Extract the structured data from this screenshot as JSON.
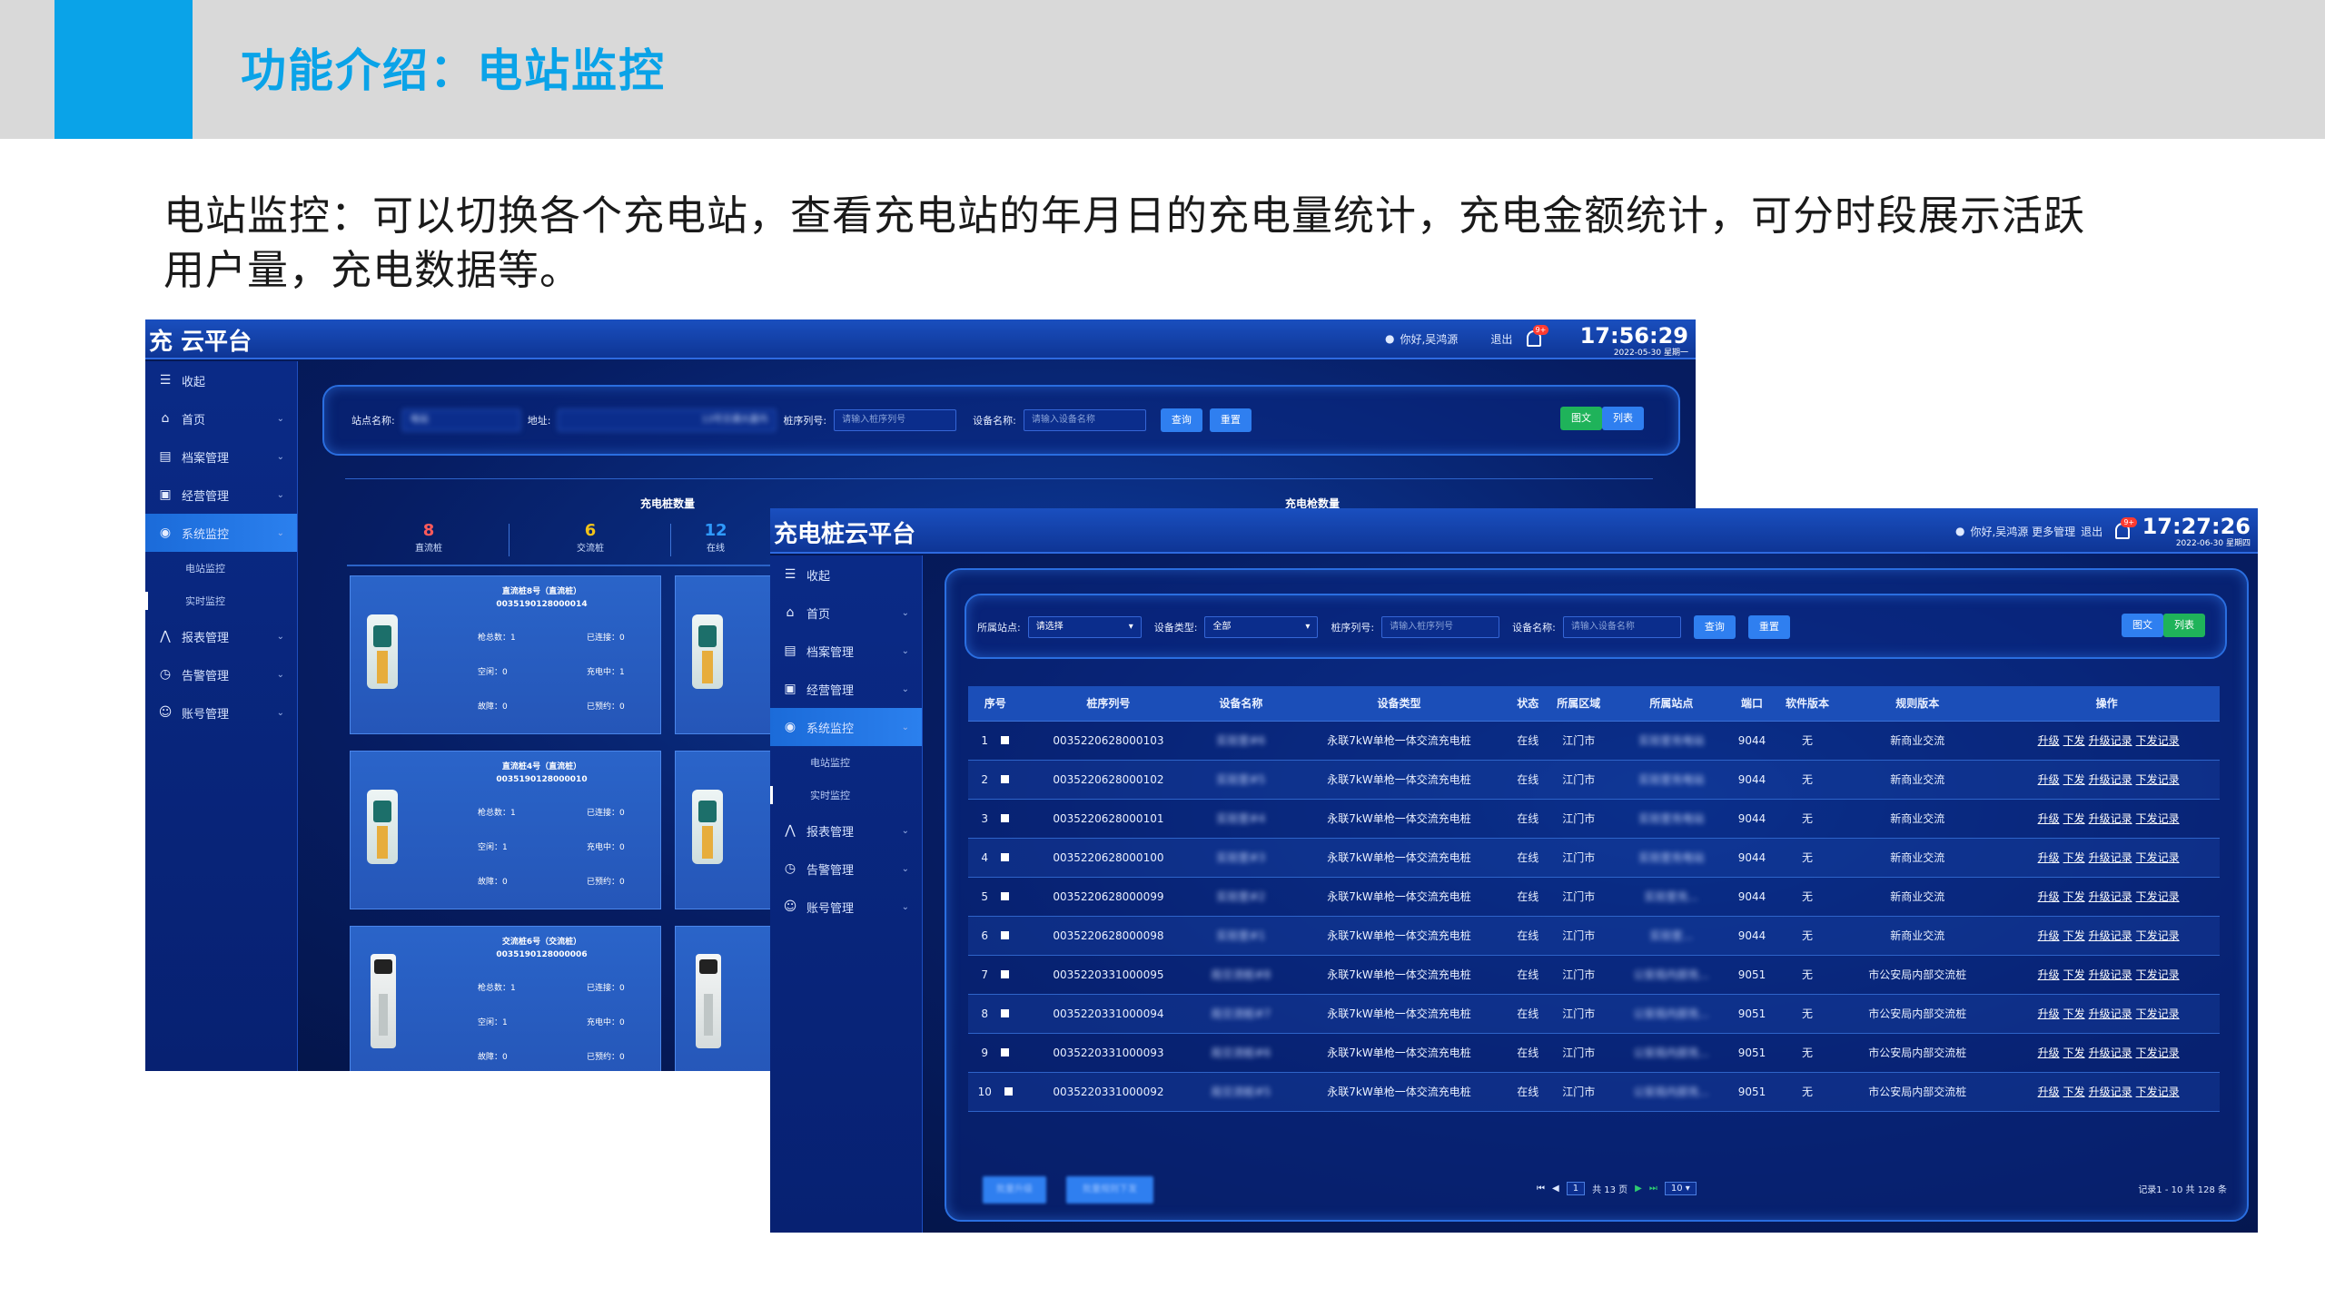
{
  "slide": {
    "title": "功能介绍：电站监控",
    "description": "电站监控：可以切换各个充电站，查看充电站的年月日的充电量统计，充电金额统计，可分时段展示活跃用户量，充电数据等。"
  },
  "colors": {
    "accent": "#0aa3e8",
    "bar": "#d9d9d9",
    "app_bg": "#061d63",
    "active_nav": "#1b6bd9"
  },
  "shot1": {
    "app_title": "充        云平台",
    "user": "你好,吴鸿源",
    "logout": "退出",
    "bell_badge": "9+",
    "time": "17:56:29",
    "date": "2022-05-30 星期一",
    "nav": [
      {
        "label": "收起",
        "icon": "menu-icon"
      },
      {
        "label": "首页",
        "icon": "home-icon"
      },
      {
        "label": "档案管理",
        "icon": "archive-icon"
      },
      {
        "label": "经营管理",
        "icon": "business-icon"
      },
      {
        "label": "系统监控",
        "icon": "monitor-icon"
      },
      {
        "label": "电站监控"
      },
      {
        "label": "实时监控"
      },
      {
        "label": "报表管理",
        "icon": "report-icon"
      },
      {
        "label": "告警管理",
        "icon": "alarm-icon"
      },
      {
        "label": "账号管理",
        "icon": "account-icon"
      }
    ],
    "search": {
      "station_label": "站点名称:",
      "station_value": "电站",
      "address_label": "地址:",
      "address_value": "13号交通大厦内",
      "serial_label": "桩序列号:",
      "serial_placeholder": "请输入桩序列号",
      "device_label": "设备名称:",
      "device_placeholder": "请输入设备名称",
      "query": "查询",
      "reset": "重置",
      "view_card": "图文",
      "view_list": "列表"
    },
    "section_left": "充电桩数量",
    "section_right": "充电枪数量",
    "stats": [
      {
        "value": "8",
        "label": "直流桩",
        "color": "#ff5a5a"
      },
      {
        "value": "6",
        "label": "交流桩",
        "color": "#f0c21a"
      },
      {
        "value": "12",
        "label": "在线",
        "color": "#2f9bff"
      }
    ],
    "cards": [
      {
        "name": "直流桩8号（直流桩）",
        "serial": "0035190128000014",
        "total": "枪总数：1",
        "connected": "已连接：0",
        "idle": "空闲：0",
        "charging": "充电中：1",
        "fault": "故障：0",
        "reserved": "已预约：0"
      },
      {
        "name": "直流桩4号（直流桩）",
        "serial": "0035190128000010",
        "total": "枪总数：1",
        "connected": "已连接：0",
        "idle": "空闲：1",
        "charging": "充电中：0",
        "fault": "故障：0",
        "reserved": "已预约：0"
      },
      {
        "name": "交流桩6号（交流桩）",
        "serial": "0035190128000006",
        "total": "枪总数：1",
        "connected": "已连接：0",
        "idle": "空闲：1",
        "charging": "充电中：0",
        "fault": "故障：0",
        "reserved": "已预约：0"
      }
    ]
  },
  "shot2": {
    "app_title": "充电桩云平台",
    "user": "你好,吴鸿源 更多管理",
    "logout": "退出",
    "bell_badge": "9+",
    "time": "17:27:26",
    "date": "2022-06-30 星期四",
    "nav": [
      {
        "label": "收起",
        "icon": "menu-icon"
      },
      {
        "label": "首页",
        "icon": "home-icon"
      },
      {
        "label": "档案管理",
        "icon": "archive-icon"
      },
      {
        "label": "经营管理",
        "icon": "business-icon"
      },
      {
        "label": "系统监控",
        "icon": "monitor-icon"
      },
      {
        "label": "电站监控"
      },
      {
        "label": "实时监控"
      },
      {
        "label": "报表管理",
        "icon": "report-icon"
      },
      {
        "label": "告警管理",
        "icon": "alarm-icon"
      },
      {
        "label": "账号管理",
        "icon": "account-icon"
      }
    ],
    "search": {
      "station_label": "所属站点:",
      "station_value": "请选择",
      "type_label": "设备类型:",
      "type_value": "全部",
      "serial_label": "桩序列号:",
      "serial_placeholder": "请输入桩序列号",
      "device_label": "设备名称:",
      "device_placeholder": "请输入设备名称",
      "query": "查询",
      "reset": "重置",
      "view_card": "图文",
      "view_list": "列表"
    },
    "table": {
      "headers": [
        "序号",
        "桩序列号",
        "设备名称",
        "设备类型",
        "状态",
        "所属区域",
        "所属站点",
        "端口",
        "软件版本",
        "规则版本",
        "操作"
      ],
      "rows": [
        {
          "no": "1",
          "serial": "0035220628000103",
          "name": "实验室#6",
          "type": "永联7kW单枪一体交流充电桩",
          "status": "在线",
          "area": "江门市",
          "station": "实验室充电站",
          "port": "9044",
          "sw": "无",
          "rule": "新商业交流"
        },
        {
          "no": "2",
          "serial": "0035220628000102",
          "name": "实验室#5",
          "type": "永联7kW单枪一体交流充电桩",
          "status": "在线",
          "area": "江门市",
          "station": "实验室充电站",
          "port": "9044",
          "sw": "无",
          "rule": "新商业交流"
        },
        {
          "no": "3",
          "serial": "0035220628000101",
          "name": "实验室#4",
          "type": "永联7kW单枪一体交流充电桩",
          "status": "在线",
          "area": "江门市",
          "station": "实验室充电站",
          "port": "9044",
          "sw": "无",
          "rule": "新商业交流"
        },
        {
          "no": "4",
          "serial": "0035220628000100",
          "name": "实验室#3",
          "type": "永联7kW单枪一体交流充电桩",
          "status": "在线",
          "area": "江门市",
          "station": "实验室充电站",
          "port": "9044",
          "sw": "无",
          "rule": "新商业交流"
        },
        {
          "no": "5",
          "serial": "0035220628000099",
          "name": "实验室#2",
          "type": "永联7kW单枪一体交流充电桩",
          "status": "在线",
          "area": "江门市",
          "station": "实验室充...",
          "port": "9044",
          "sw": "无",
          "rule": "新商业交流"
        },
        {
          "no": "6",
          "serial": "0035220628000098",
          "name": "实验室#1",
          "type": "永联7kW单枪一体交流充电桩",
          "status": "在线",
          "area": "江门市",
          "station": "实验室...",
          "port": "9044",
          "sw": "无",
          "rule": "新商业交流"
        },
        {
          "no": "7",
          "serial": "0035220331000095",
          "name": "局交流桩#8",
          "type": "永联7kW单枪一体交流充电桩",
          "status": "在线",
          "area": "江门市",
          "station": "公安局内部充...",
          "port": "9051",
          "sw": "无",
          "rule": "市公安局内部交流桩"
        },
        {
          "no": "8",
          "serial": "0035220331000094",
          "name": "局交流桩#7",
          "type": "永联7kW单枪一体交流充电桩",
          "status": "在线",
          "area": "江门市",
          "station": "公安局内部充...",
          "port": "9051",
          "sw": "无",
          "rule": "市公安局内部交流桩"
        },
        {
          "no": "9",
          "serial": "0035220331000093",
          "name": "局交流桩#6",
          "type": "永联7kW单枪一体交流充电桩",
          "status": "在线",
          "area": "江门市",
          "station": "公安局内部充...",
          "port": "9051",
          "sw": "无",
          "rule": "市公安局内部交流桩"
        },
        {
          "no": "10",
          "serial": "0035220331000092",
          "name": "局交流桩#5",
          "type": "永联7kW单枪一体交流充电桩",
          "status": "在线",
          "area": "江门市",
          "station": "公安局内部充...",
          "port": "9051",
          "sw": "无",
          "rule": "市公安局内部交流桩"
        }
      ],
      "ops": [
        "升级",
        "下发",
        "升级记录",
        "下发记录"
      ]
    },
    "footer": {
      "btn1": "批量升级",
      "btn2": "批量规则下发",
      "page": "1",
      "total_pages": "共 13 页",
      "page_size": "10",
      "summary": "记录1 - 10 共 128 条"
    }
  }
}
